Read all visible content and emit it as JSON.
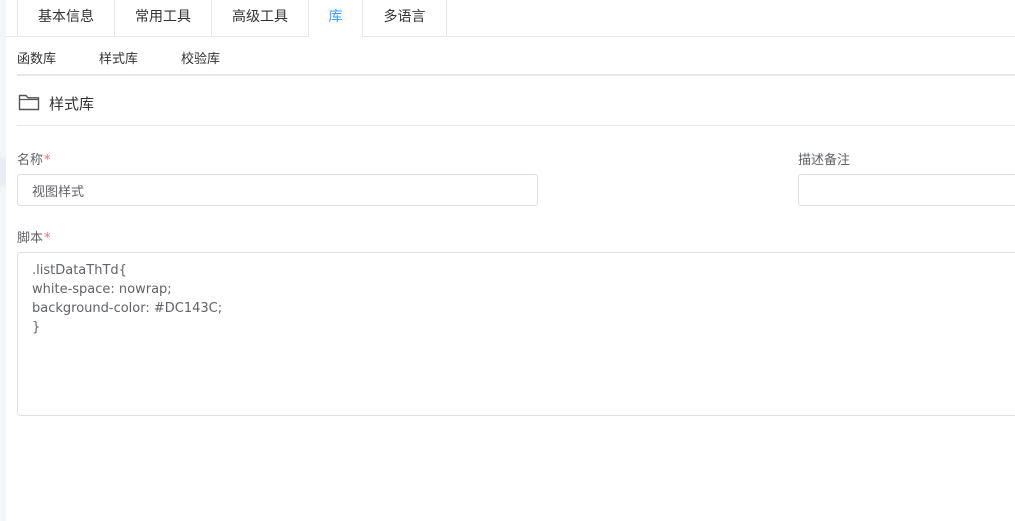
{
  "tabs": [
    {
      "label": "基本信息"
    },
    {
      "label": "常用工具"
    },
    {
      "label": "高级工具"
    },
    {
      "label": "库"
    },
    {
      "label": "多语言"
    }
  ],
  "active_tab": "库",
  "sub_tabs": [
    {
      "label": "函数库"
    },
    {
      "label": "样式库"
    },
    {
      "label": "校验库"
    }
  ],
  "section": {
    "icon": "folder-icon",
    "title": "样式库"
  },
  "form": {
    "name_label": "名称",
    "name_value": "视图样式",
    "required_mark": "*",
    "description_label": "描述备注",
    "description_value": "",
    "script_label": "脚本",
    "script_value": ".listDataThTd{\nwhite-space: nowrap;\nbackground-color: #DC143C;\n}"
  },
  "colors": {
    "active_tab": "#409eff",
    "required": "#f56c6c",
    "border": "#dcdfe6"
  }
}
